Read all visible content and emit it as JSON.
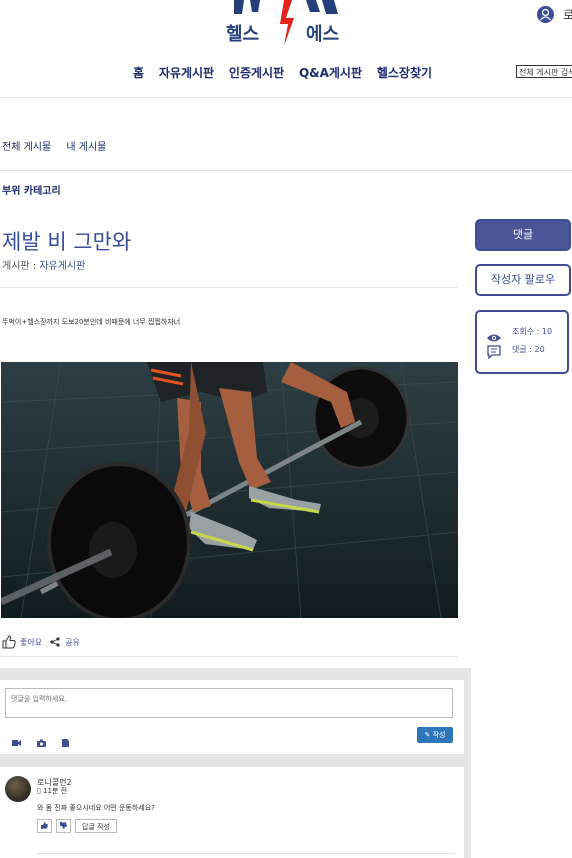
{
  "header": {
    "logo_left": "헬스",
    "logo_right": "에스",
    "login_label": "로"
  },
  "nav": {
    "items": [
      "홈",
      "자유게시판",
      "인증게시판",
      "Q&A게시판",
      "헬스장찾기"
    ],
    "search_placeholder": "전체 게시판 검색"
  },
  "board_tabs": [
    "전체 게시물",
    "내 게시물"
  ],
  "category_label": "부위 카테고리",
  "post": {
    "title": "제발 비 그만와",
    "board_prefix": "게시판 : ",
    "board_name": "자유게시판",
    "body": "뚜벅이+헬스장까지 도보20분인데 비때문에 너무 찝찝하자너",
    "like_label": "좋아요",
    "share_label": "공유"
  },
  "sidebar": {
    "comment_button": "댓글",
    "follow_button": "작성자 팔로우",
    "views_label": "조회수 : 10",
    "comments_label": "댓글 : 20"
  },
  "comment_form": {
    "placeholder": "댓글을 입력하세요.",
    "submit_label": "✎ 작성"
  },
  "comments": [
    {
      "author": "로니콜먼2",
      "time": "▯ 11분 전",
      "text": "와 몸 진짜 좋으시네요 어떤 운동하세요?",
      "reply_label": "답글 작성"
    }
  ],
  "colors": {
    "accent": "#3f4d92",
    "logo_red": "#e2231a",
    "write_button": "#2d76b9"
  }
}
